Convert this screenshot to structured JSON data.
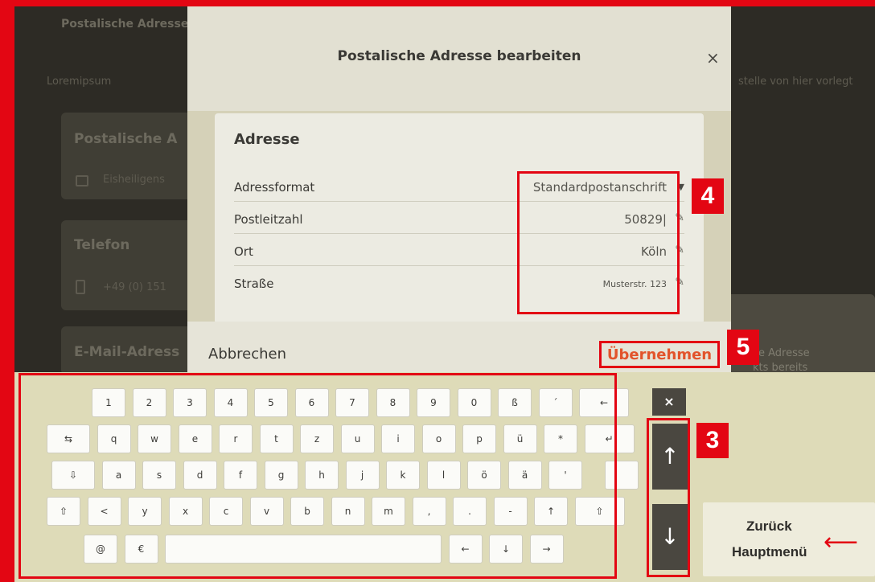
{
  "background": {
    "top_text": "Postalische Adressen",
    "sub_text": "Loremipsum",
    "right_sub_text": "stelle von hier vorlegt",
    "postal_card": {
      "title": "Postalische A",
      "line": "Eisheiligens"
    },
    "phone_card": {
      "title": "Telefon",
      "line": "+49 (0) 151"
    },
    "email_card": {
      "title": "E-Mail-Adress"
    },
    "right_card": {
      "line1": "e Adresse",
      "line2": "kts bereits"
    }
  },
  "modal": {
    "title": "Postalische Adresse bearbeiten",
    "close_icon": "×",
    "card_title": "Adresse",
    "rows": [
      {
        "label": "Adressformat",
        "value": "Standardpostanschrift",
        "type": "select",
        "icon": "▼"
      },
      {
        "label": "Postleitzahl",
        "value": "50829|",
        "type": "edit",
        "icon": "pencil-icon"
      },
      {
        "label": "Ort",
        "value": "Köln",
        "type": "edit",
        "icon": "pencil-icon"
      },
      {
        "label": "Straße",
        "value": "Musterstr. 123",
        "type": "edit",
        "icon": "pencil-icon"
      }
    ],
    "cancel_label": "Abbrechen",
    "apply_label": "Übernehmen"
  },
  "keyboard": {
    "rows": [
      [
        "1",
        "2",
        "3",
        "4",
        "5",
        "6",
        "7",
        "8",
        "9",
        "0",
        "ß",
        "´",
        "←"
      ],
      [
        "⇆",
        "q",
        "w",
        "e",
        "r",
        "t",
        "z",
        "u",
        "i",
        "o",
        "p",
        "ü",
        "*",
        "↵"
      ],
      [
        "⇩",
        "a",
        "s",
        "d",
        "f",
        "g",
        "h",
        "j",
        "k",
        "l",
        "ö",
        "ä",
        "'"
      ],
      [
        "⇧",
        "<",
        "y",
        "x",
        "c",
        "v",
        "b",
        "n",
        "m",
        ",",
        ".",
        "-",
        "↑",
        "⇧"
      ],
      [
        "@",
        "€",
        "",
        "←",
        "↓",
        "→"
      ]
    ],
    "close_label": "×",
    "scroll_up": "↑",
    "scroll_down": "↓"
  },
  "back_button": {
    "line1": "Zurück",
    "line2": "Hauptmenü"
  },
  "callouts": {
    "c3": "3",
    "c4": "4",
    "c5": "5"
  },
  "colors": {
    "accent": "#e30613",
    "apply": "#e2532b"
  }
}
